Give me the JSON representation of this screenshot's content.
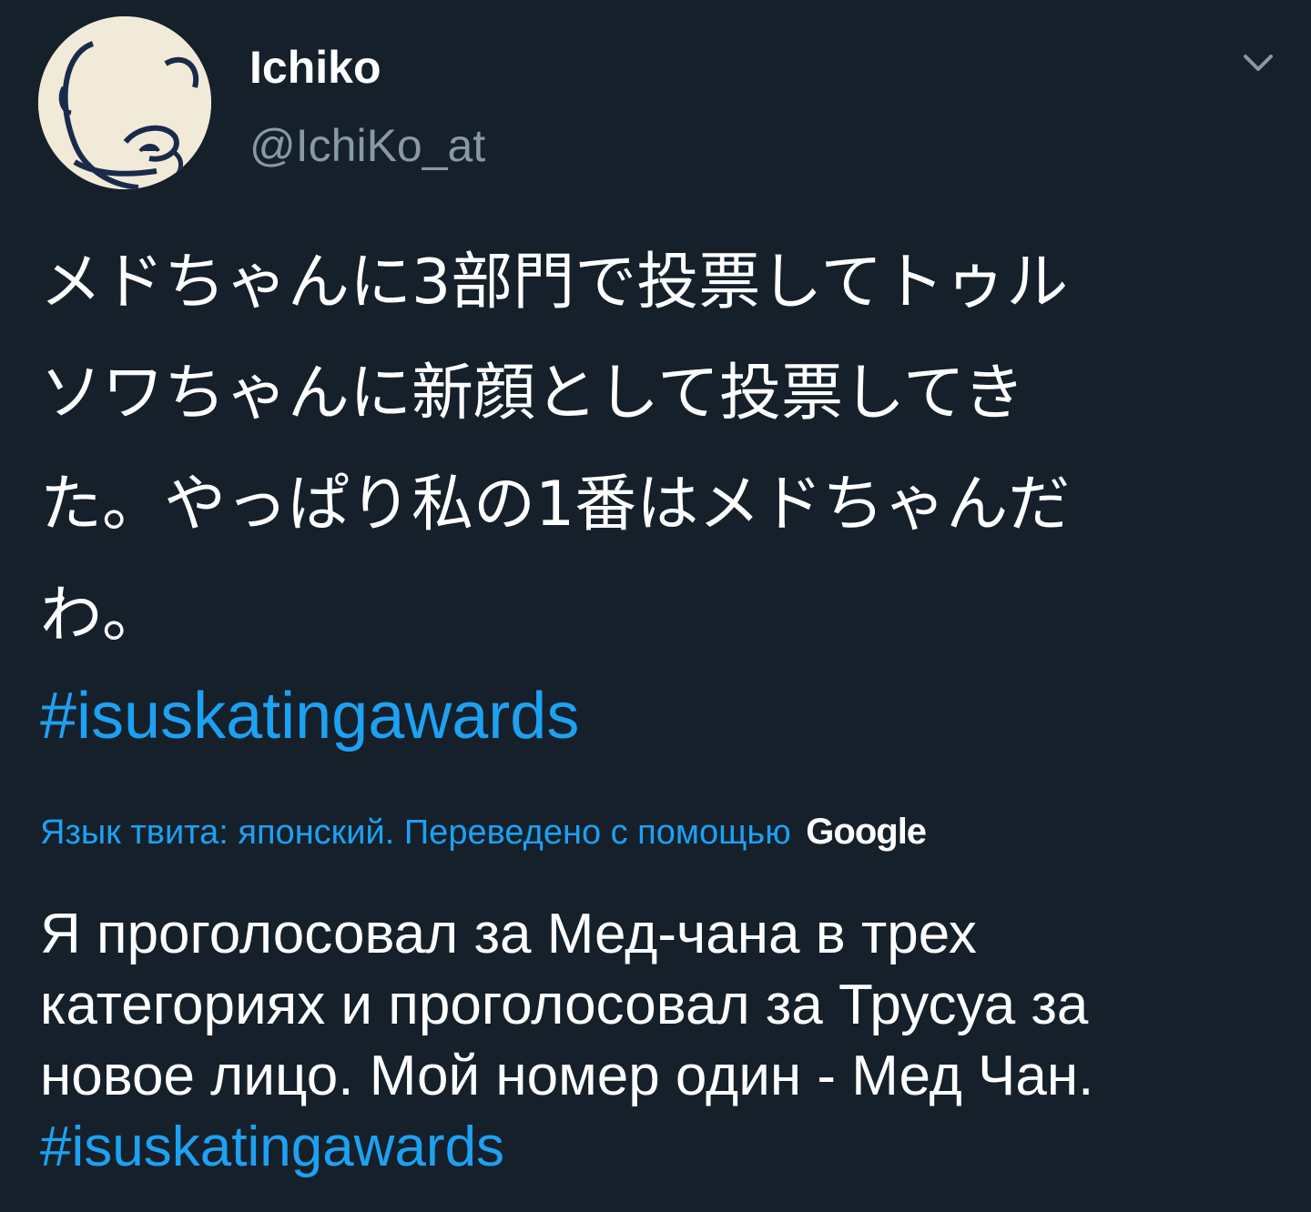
{
  "author": {
    "display_name": "Ichiko",
    "handle": "@IchiKo_at",
    "avatar_icon": "avatar-drawing-icon"
  },
  "menu": {
    "icon": "chevron-down-icon"
  },
  "tweet": {
    "lines": [
      "メドちゃんに3部門で投票してトゥル",
      "ソワちゃんに新顔として投票してき",
      "た。やっぱり私の1番はメドちゃんだ",
      "わ。"
    ],
    "hashtag": "#isuskatingawards"
  },
  "translation_notice": {
    "text": "Язык твита: японский. Переведено с помощью",
    "provider": "Google"
  },
  "translation": {
    "lines": [
      "Я проголосовал за Мед-чана в трех",
      "категориях и проголосовал за Трусуа за",
      "новое лицо. Мой номер один - Мед Чан."
    ],
    "hashtag": "#isuskatingawards"
  },
  "colors": {
    "background": "#15202b",
    "text": "#ffffff",
    "secondary": "#8899a6",
    "link": "#1da1f2"
  }
}
